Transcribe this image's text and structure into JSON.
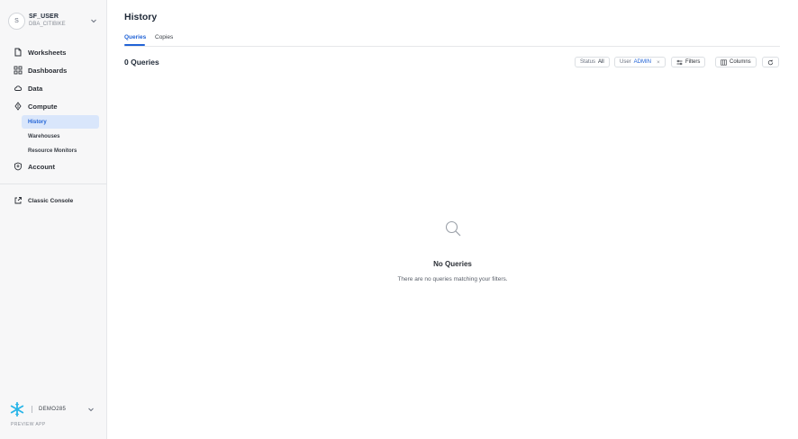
{
  "user": {
    "avatar_initial": "S",
    "name": "SF_USER",
    "role": "DBA_CITIBIKE"
  },
  "sidebar": {
    "items": [
      {
        "label": "Worksheets",
        "icon": "document-icon"
      },
      {
        "label": "Dashboards",
        "icon": "grid-icon"
      },
      {
        "label": "Data",
        "icon": "cloud-icon"
      },
      {
        "label": "Compute",
        "icon": "compute-icon"
      }
    ],
    "compute_sub": [
      "History",
      "Warehouses",
      "Resource Monitors"
    ],
    "account_label": "Account",
    "classic_console_label": "Classic Console",
    "account_name": "DEMO285",
    "preview_label": "PREVIEW APP"
  },
  "page": {
    "title": "History",
    "tabs": [
      "Queries",
      "Copies"
    ],
    "count_label": "0 Queries"
  },
  "filters": {
    "status_label": "Status",
    "status_value": "All",
    "user_label": "User",
    "user_value": "ADMIN",
    "clear_symbol": "×",
    "filters_button": "Filters",
    "columns_button": "Columns"
  },
  "empty_state": {
    "title": "No Queries",
    "message": "There are no queries matching your filters."
  },
  "colors": {
    "accent": "#2163d6",
    "active_bg": "#d9e6fb",
    "sidebar_bg": "#f7f7f8",
    "snowflake": "#29b5e8"
  }
}
